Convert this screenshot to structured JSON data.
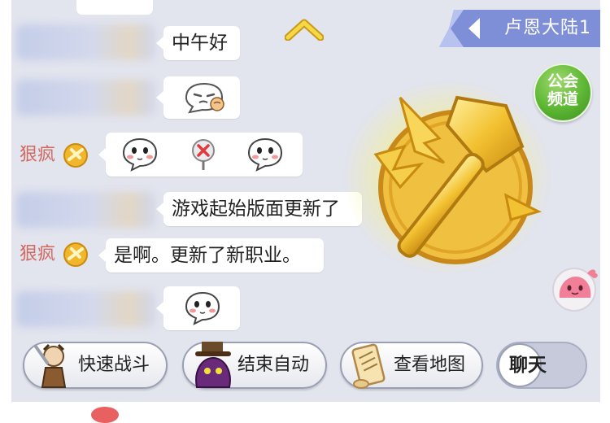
{
  "header": {
    "channel_name": "卢恩大陆1",
    "guild_channel_label": "公会\n频道"
  },
  "chat": {
    "messages": [
      {
        "sender": "",
        "blurred": true,
        "text": "中午好"
      },
      {
        "sender": "",
        "blurred": true,
        "emoji": [
          "sleepy-face-emoji"
        ]
      },
      {
        "sender": "狠疯",
        "blurred": false,
        "emoji": [
          "blush-ghost-emoji",
          "red-x-pin-emoji",
          "blush-ghost-emoji"
        ]
      },
      {
        "sender": "",
        "blurred": true,
        "text": "游戏起始版面更新了"
      },
      {
        "sender": "狠疯",
        "blurred": false,
        "text": "是啊。更新了新职业。"
      },
      {
        "sender": "",
        "blurred": true,
        "emoji": [
          "blush-ghost-emoji"
        ]
      }
    ]
  },
  "actions": {
    "quick_battle": "快速战斗",
    "end_auto": "结束自动",
    "view_map": "查看地图",
    "chat": "聊天"
  },
  "icons": {
    "battle_emblem": "golden-axe-icon",
    "pet": "pink-poring-icon",
    "scroll_up": "chevron-up-icon"
  },
  "colors": {
    "sender_name": "#d36a62",
    "banner": "#7e8fd8",
    "guild": "#5cb633",
    "emblem": "#f2c230"
  }
}
